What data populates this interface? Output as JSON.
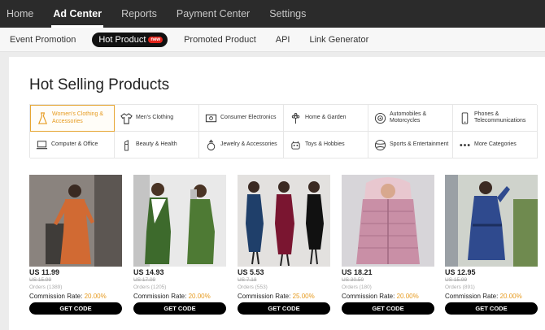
{
  "topnav": [
    "Home",
    "Ad Center",
    "Reports",
    "Payment Center",
    "Settings"
  ],
  "subnav": {
    "items": [
      "Event Promotion",
      "Hot Product",
      "Promoted Product",
      "API",
      "Link Generator"
    ],
    "new_badge": "new"
  },
  "title": "Hot Selling Products",
  "categories": [
    {
      "label": "Women's Clothing & Accessories",
      "icon": "dress-icon"
    },
    {
      "label": "Men's Clothing",
      "icon": "shirt-icon"
    },
    {
      "label": "Consumer Electronics",
      "icon": "monitor-icon"
    },
    {
      "label": "Home & Garden",
      "icon": "flower-icon"
    },
    {
      "label": "Automobiles & Motorcycles",
      "icon": "wheel-icon"
    },
    {
      "label": "Phones & Telecommunications",
      "icon": "phone-icon"
    },
    {
      "label": "Computer & Office",
      "icon": "laptop-icon"
    },
    {
      "label": "Beauty & Health",
      "icon": "lipstick-icon"
    },
    {
      "label": "Jewelry & Accessories",
      "icon": "ring-icon"
    },
    {
      "label": "Toys & Hobbies",
      "icon": "toy-icon"
    },
    {
      "label": "Sports & Entertainment",
      "icon": "ball-icon"
    },
    {
      "label": "More Categories",
      "icon": "dots-icon"
    }
  ],
  "products": [
    {
      "price": "US 11.99",
      "old_price": "US 15.99",
      "orders": "Orders (1389)",
      "rate_label": "Commission Rate: ",
      "rate": "20.00%",
      "button": "GET CODE"
    },
    {
      "price": "US 14.93",
      "old_price": "US 17.09",
      "orders": "Orders (1205)",
      "rate_label": "Commission Rate: ",
      "rate": "20.00%",
      "button": "GET CODE"
    },
    {
      "price": "US 5.53",
      "old_price": "US 7.18",
      "orders": "Orders (553)",
      "rate_label": "Commission Rate: ",
      "rate": "25.00%",
      "button": "GET CODE"
    },
    {
      "price": "US 18.21",
      "old_price": "US 30.50",
      "orders": "Orders (180)",
      "rate_label": "Commission Rate: ",
      "rate": "20.00%",
      "button": "GET CODE"
    },
    {
      "price": "US 12.95",
      "old_price": "US 15.99",
      "orders": "Orders (891)",
      "rate_label": "Commission Rate: ",
      "rate": "20.00%",
      "button": "GET CODE"
    }
  ],
  "colors": {
    "accent": "#e69a1e",
    "topbar": "#2b2b2b",
    "button": "#000000"
  }
}
